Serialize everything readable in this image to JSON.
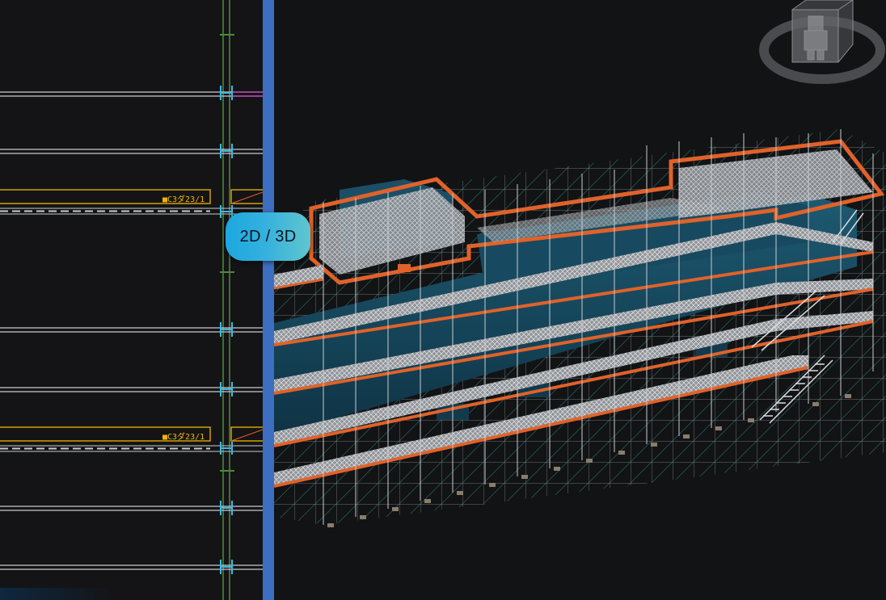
{
  "toggle": {
    "label": "2D / 3D"
  },
  "plan_tags": [
    "■C3ダ23/1",
    "■C3ダ23/1"
  ],
  "colors": {
    "background": "#141416",
    "divider": "#3c6ec2",
    "toggle_gradient_start": "#1ba8e0",
    "toggle_gradient_end": "#5fc6cf",
    "tank_fill": "#16485c",
    "deck_edge": "#e0622a",
    "scaffold_brace": "#4fc7c3",
    "scaffold_frame": "#c8cbcf",
    "plan_highlight": "#f2b400"
  },
  "icons": {
    "viewcube": "viewcube-icon",
    "orbit_ring": "orbit-ring-icon"
  }
}
